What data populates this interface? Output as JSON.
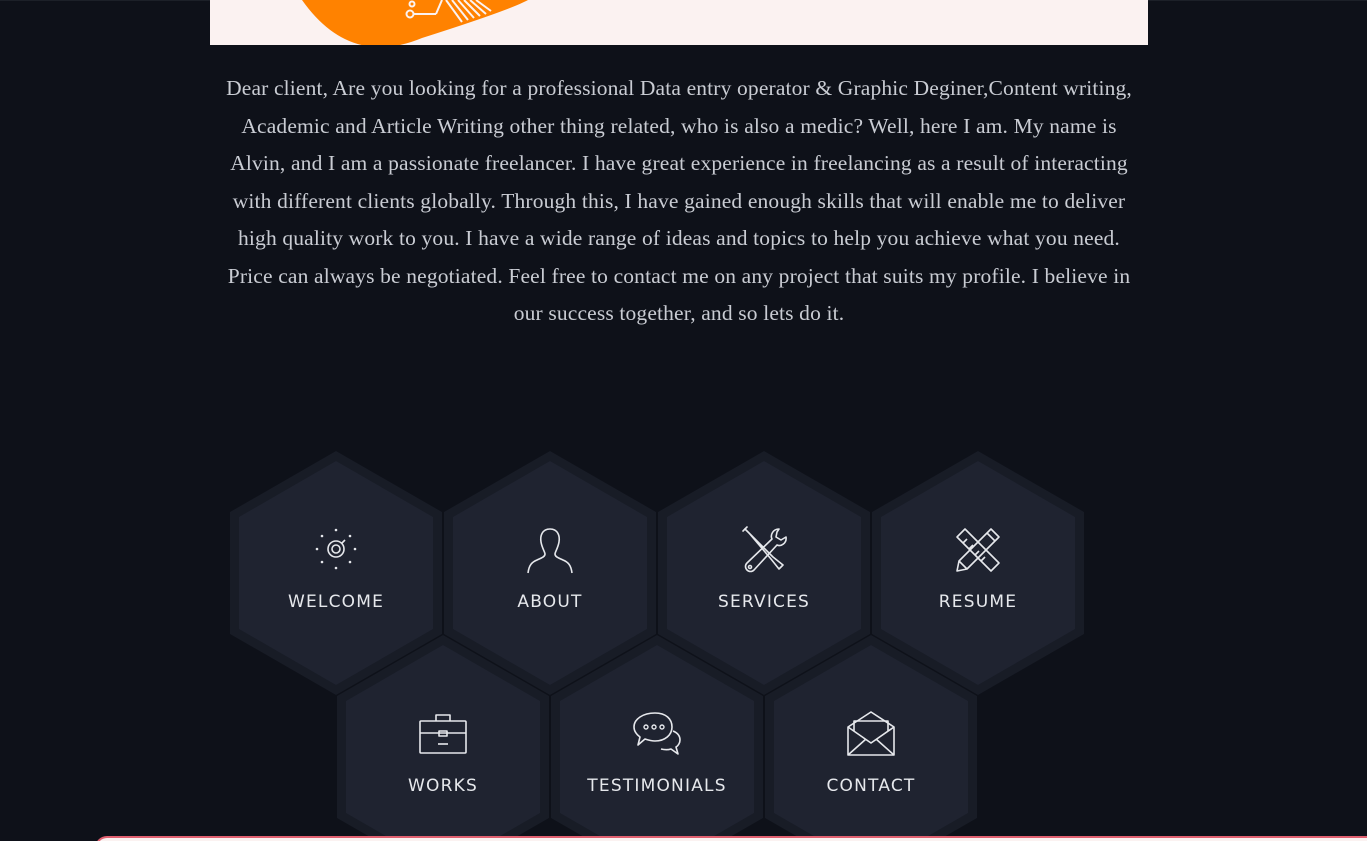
{
  "intro": {
    "text": "Dear client, Are you looking for a professional Data entry operator & Graphic Deginer,Content writing, Academic and Article Writing other thing related, who is also a medic? Well, here I am. My name is Alvin, and I am a passionate freelancer. I have great experience in freelancing as a result of interacting with different clients globally. Through this, I have gained enough skills that will enable me to deliver high quality work to you. I have a wide range of ideas and topics to help you achieve what you need. Price can always be negotiated. Feel free to contact me on any project that suits my profile. I believe in our success together, and so lets do it."
  },
  "menu": {
    "items": [
      {
        "label": "WELCOME",
        "icon": "sun-eye-icon"
      },
      {
        "label": "ABOUT",
        "icon": "user-icon"
      },
      {
        "label": "SERVICES",
        "icon": "tools-icon"
      },
      {
        "label": "RESUME",
        "icon": "ruler-pencil-icon"
      },
      {
        "label": "WORKS",
        "icon": "briefcase-icon"
      },
      {
        "label": "TESTIMONIALS",
        "icon": "chat-bubbles-icon"
      },
      {
        "label": "CONTACT",
        "icon": "envelope-icon"
      }
    ]
  },
  "colors": {
    "background": "#0e1119",
    "hex_fill": "#1e2230",
    "hex_border": "#181c26",
    "text": "#c9ccd3",
    "accent_orange": "#ff8200",
    "banner_bg": "#fbf2f1"
  }
}
